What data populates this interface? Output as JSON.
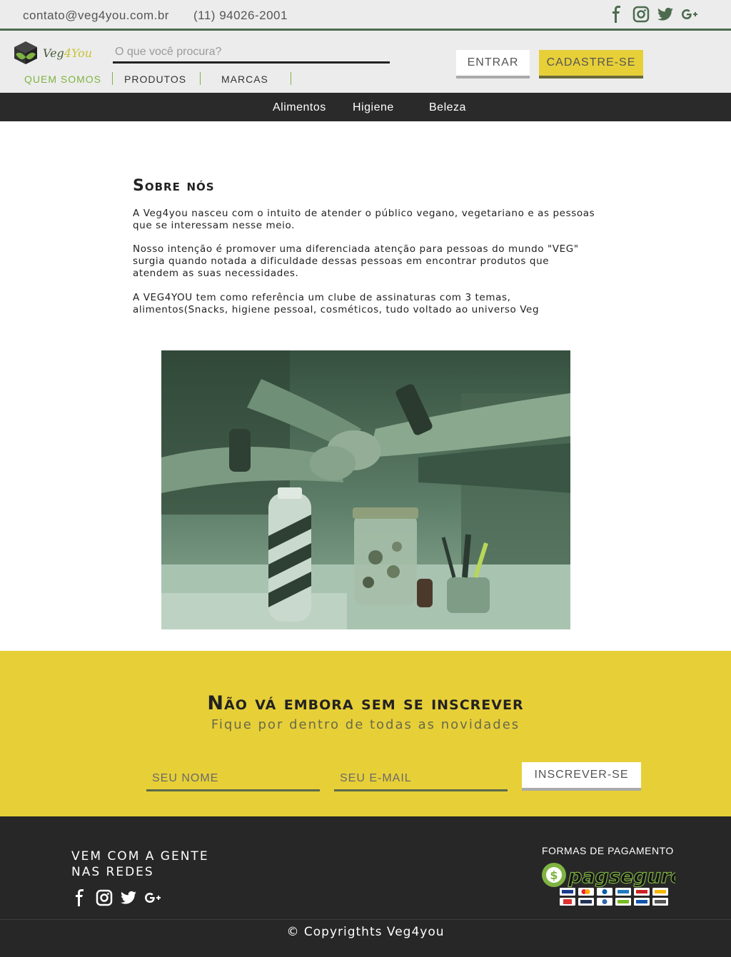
{
  "topbar": {
    "email": "contato@veg4you.com.br",
    "phone": "(11) 94026-2001",
    "social_icons": [
      "facebook-icon",
      "instagram-icon",
      "twitter-icon",
      "google-plus-icon"
    ]
  },
  "header": {
    "logo_text_a": "Veg",
    "logo_text_b": "4You",
    "search_placeholder": "O que você procura?",
    "login_label": "ENTRAR",
    "signup_label": "CADASTRE-SE",
    "nav": [
      "QUEM SOMOS",
      "PRODUTOS",
      "MARCAS"
    ]
  },
  "categories": [
    "Alimentos",
    "Higiene",
    "Beleza"
  ],
  "about": {
    "title": "Sobre nós",
    "paragraphs": [
      "A Veg4you nasceu com o intuito de atender o público vegano, vegetariano e as pessoas que se interessam nesse meio.",
      "Nosso intenção é promover uma diferenciada atenção para pessoas do mundo \"VEG\" surgia quando notada a dificuldade dessas pessoas em encontrar produtos que atendem as suas necessidades.",
      "A VEG4YOU tem como referência um clube de assinaturas com 3 temas, alimentos(Snacks, higiene pessoal, cosméticos, tudo voltado ao universo Veg"
    ]
  },
  "newsletter": {
    "title": "Não vá embora sem se inscrever",
    "subtitle": "Fique por dentro de todas as novidades",
    "name_placeholder": "SEU NOME",
    "email_placeholder": "SEU E-MAIL",
    "button_label": "INSCREVER-SE"
  },
  "footer": {
    "social_title": "VEM COM A GENTE NAS REDES",
    "payment_title": "FORMAS DE PAGAMENTO",
    "payment_brand": "pagseguro",
    "copyright": "© Copyrigthts Veg4you"
  },
  "colors": {
    "accent_yellow": "#e7cf38",
    "accent_green": "#7fb342",
    "dark": "#272727"
  }
}
